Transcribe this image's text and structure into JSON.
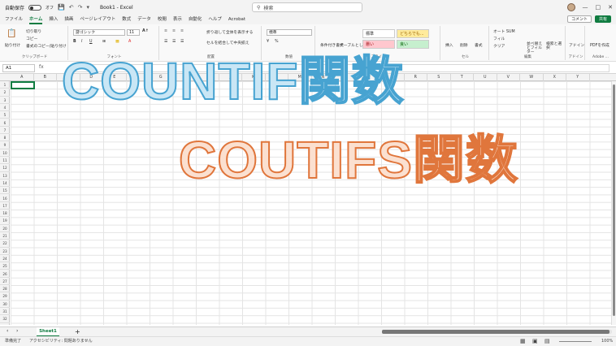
{
  "titlebar": {
    "autosave_label": "自動保存",
    "autosave_state": "オフ",
    "doc_title": "Book1 - Excel",
    "search_placeholder": "検索"
  },
  "menu": {
    "tabs": [
      "ファイル",
      "ホーム",
      "挿入",
      "描画",
      "ページレイアウト",
      "数式",
      "データ",
      "校閲",
      "表示",
      "自動化",
      "ヘルプ",
      "Acrobat"
    ],
    "active_tab": "ホーム",
    "comment_label": "コメント",
    "share_label": "共有"
  },
  "ribbon": {
    "clipboard": {
      "paste": "貼り付け",
      "cut": "切り取り",
      "copy": "コピー",
      "format_painter": "書式のコピー/貼り付け",
      "label": "クリップボード"
    },
    "font": {
      "font_name": "游ゴシック",
      "font_size": "11",
      "label": "フォント"
    },
    "alignment": {
      "wrap": "折り返して全体を表示する",
      "merge": "セルを結合して中央揃え",
      "label": "配置"
    },
    "number": {
      "format": "標準",
      "label": "数値"
    },
    "styles": {
      "conditional": "条件付き書式",
      "as_table": "テーブルとして書式設定",
      "normal": "標準",
      "neutral": "どちらでも...",
      "bad": "悪い",
      "good": "良い",
      "label": "スタイル"
    },
    "cells": {
      "insert": "挿入",
      "delete": "削除",
      "format": "書式",
      "label": "セル"
    },
    "editing": {
      "autosum": "オート SUM",
      "fill": "フィル",
      "clear": "クリア",
      "sort_filter": "並べ替えとフィルター",
      "find_select": "検索と選択",
      "label": "編集"
    },
    "addins": {
      "label": "アドイン",
      "btn": "アドイン"
    },
    "adobe": {
      "label": "Adobe ...",
      "btn": "PDFを作成"
    }
  },
  "formula_bar": {
    "name_box": "A1",
    "fx": "fx"
  },
  "columns": [
    "A",
    "B",
    "C",
    "D",
    "E",
    "F",
    "G",
    "H",
    "I",
    "J",
    "K",
    "L",
    "M",
    "N",
    "O",
    "P",
    "Q",
    "R",
    "S",
    "T",
    "U",
    "V",
    "W",
    "X",
    "Y"
  ],
  "rows": [
    "1",
    "2",
    "3",
    "4",
    "5",
    "6",
    "7",
    "8",
    "9",
    "10",
    "11",
    "12",
    "13",
    "14",
    "15",
    "16",
    "17",
    "18",
    "19",
    "20",
    "21",
    "22",
    "23",
    "24",
    "25",
    "26",
    "27",
    "28",
    "29",
    "30",
    "31",
    "32"
  ],
  "overlay": {
    "line1": "COUNTIF関数",
    "line2": "COUTIFS関数"
  },
  "sheets": {
    "active": "Sheet1",
    "add": "+"
  },
  "status": {
    "ready": "準備完了",
    "accessibility": "アクセシビリティ: 問題ありません",
    "zoom": "100%"
  }
}
